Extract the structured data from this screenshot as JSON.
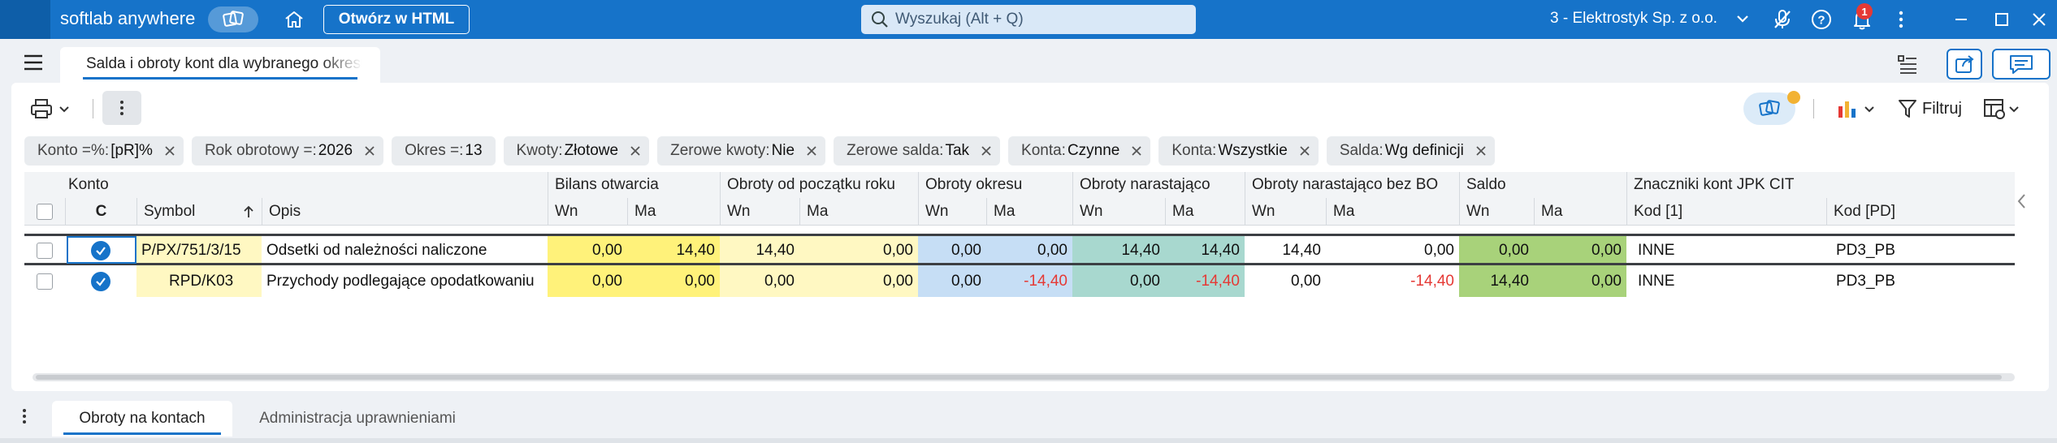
{
  "topbar": {
    "brand": "softlab anywhere",
    "open_html_label": "Otwórz w HTML",
    "search_placeholder": "Wyszukaj (Alt + Q)",
    "company": "3 - Elektrostyk Sp. z o.o.",
    "notification_count": "1"
  },
  "document_tab": {
    "label": "Salda i obroty kont dla wybranego okresu"
  },
  "toolbar": {
    "filter_label": "Filtruj"
  },
  "chips": [
    {
      "key": "Konto =%: ",
      "value": "[pR]%"
    },
    {
      "key": "Rok obrotowy =: ",
      "value": "2026"
    },
    {
      "key": "Okres =: ",
      "value": "13"
    },
    {
      "key": "Kwoty: ",
      "value": "Złotowe"
    },
    {
      "key": "Zerowe kwoty: ",
      "value": "Nie"
    },
    {
      "key": "Zerowe salda: ",
      "value": "Tak"
    },
    {
      "key": "Konta: ",
      "value": "Czynne"
    },
    {
      "key": "Konta: ",
      "value": "Wszystkie"
    },
    {
      "key": "Salda: ",
      "value": "Wg definicji"
    }
  ],
  "grid": {
    "groups": {
      "konto": "Konto",
      "bilans": "Bilans otwarcia",
      "obroty_pr": "Obroty od początku roku",
      "obroty_okresu": "Obroty okresu",
      "obroty_nar": "Obroty narastająco",
      "obroty_nar_bo": "Obroty narastająco bez BO",
      "saldo": "Saldo",
      "jpk": "Znaczniki kont JPK CIT"
    },
    "columns": {
      "c": "C",
      "symbol": "Symbol",
      "opis": "Opis",
      "wn": "Wn",
      "ma": "Ma",
      "kod1": "Kod [1]",
      "kodpd": "Kod [PD]"
    },
    "rows": [
      {
        "symbol": "P/PX/751/3/15",
        "opis": "Odsetki od należności naliczone",
        "bo_wn": "0,00",
        "bo_ma": "14,40",
        "pr_wn": "14,40",
        "pr_ma": "0,00",
        "ok_wn": "0,00",
        "ok_ma": "0,00",
        "nar_wn": "14,40",
        "nar_ma": "14,40",
        "nbo_wn": "14,40",
        "nbo_ma": "0,00",
        "s_wn": "0,00",
        "s_ma": "0,00",
        "kod1": "INNE",
        "kodpd": "PD3_PB"
      },
      {
        "symbol": "RPD/K03",
        "opis": "Przychody podlegające opodatkowaniu",
        "bo_wn": "0,00",
        "bo_ma": "0,00",
        "pr_wn": "0,00",
        "pr_ma": "0,00",
        "ok_wn": "0,00",
        "ok_ma": "-14,40",
        "nar_wn": "0,00",
        "nar_ma": "-14,40",
        "nbo_wn": "0,00",
        "nbo_ma": "-14,40",
        "s_wn": "14,40",
        "s_ma": "0,00",
        "kod1": "INNE",
        "kodpd": "PD3_PB"
      }
    ]
  },
  "bottom_tabs": [
    {
      "label": "Obroty na kontach"
    },
    {
      "label": "Administracja uprawnieniami"
    }
  ],
  "colors": {
    "accent": "#1673c9",
    "bilans_bg": "#fff27a",
    "obroty_pr_bg": "#fff8c2",
    "obroty_okresu_bg": "#c6def5",
    "obroty_nar_bg": "#a8d8cf",
    "saldo_bg": "#a8d27a",
    "negative": "#e53935"
  }
}
